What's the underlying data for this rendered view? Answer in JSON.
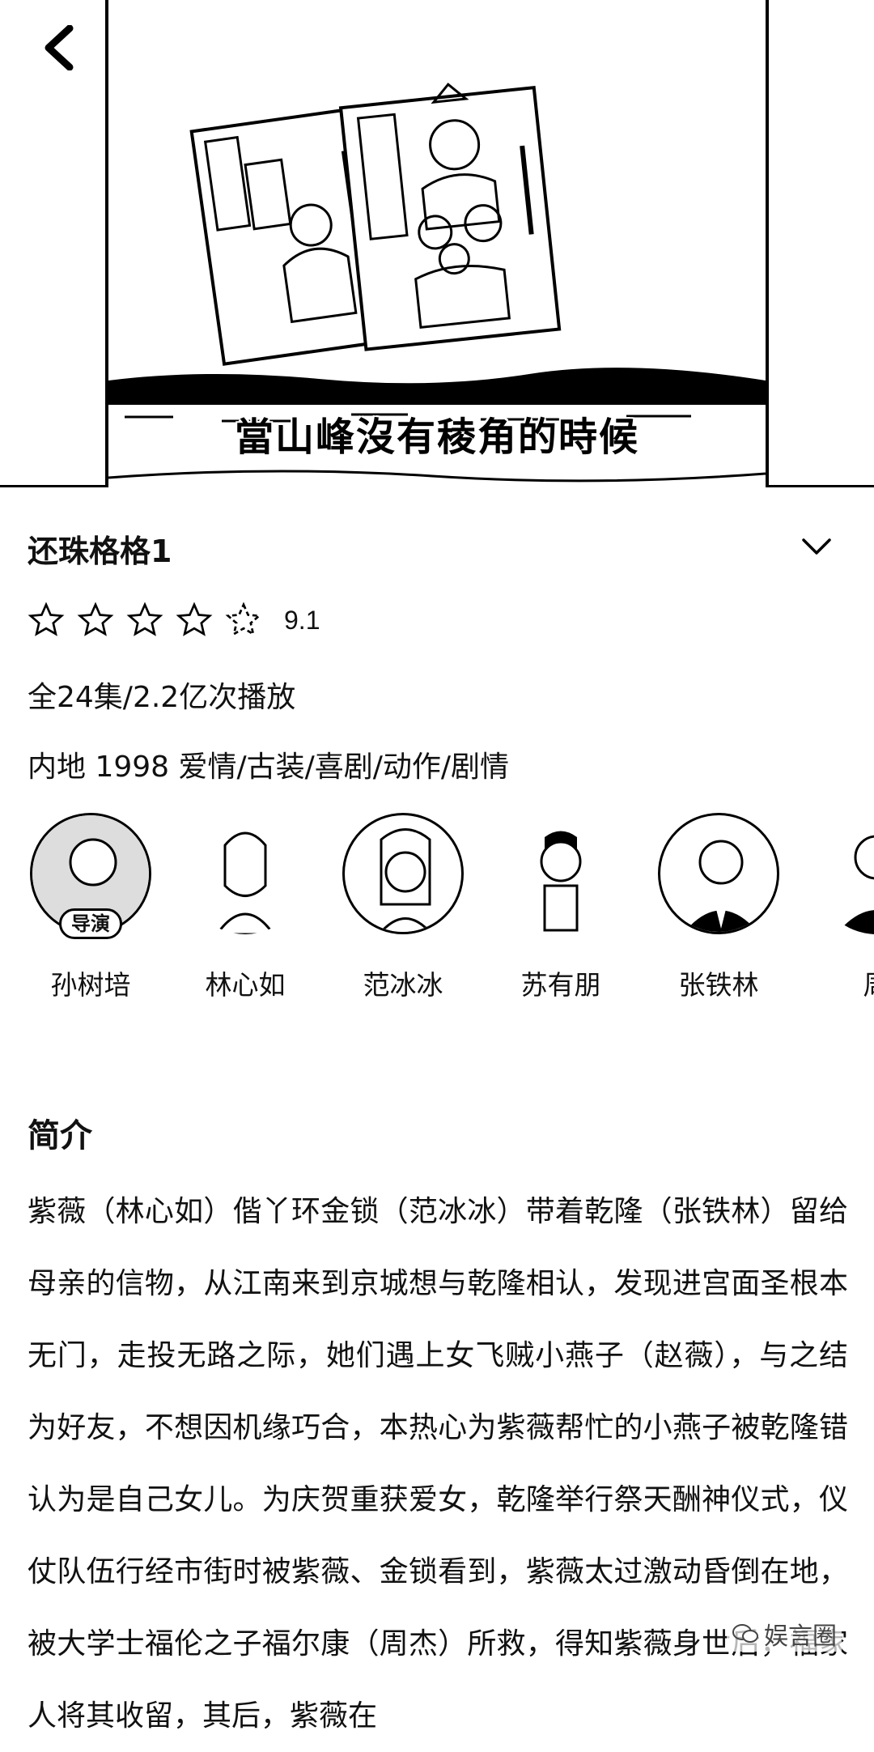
{
  "player": {
    "subtitle": "當山峰沒有稜角的時候"
  },
  "show": {
    "title": "还珠格格1",
    "rating": {
      "stars": 4.5,
      "max_stars": 5,
      "score": "9.1"
    },
    "episodes_plays": "全24集/2.2亿次播放",
    "meta": "内地 1998 爱情/古装/喜剧/动作/剧情"
  },
  "cast": [
    {
      "name": "孙树培",
      "role": "导演"
    },
    {
      "name": "林心如"
    },
    {
      "name": "范冰冰"
    },
    {
      "name": "苏有朋"
    },
    {
      "name": "张铁林"
    },
    {
      "name": "周"
    }
  ],
  "synopsis": {
    "heading": "简介",
    "text": "紫薇（林心如）偕丫环金锁（范冰冰）带着乾隆（张铁林）留给母亲的信物，从江南来到京城想与乾隆相认，发现进宫面圣根本无门，走投无路之际，她们遇上女飞贼小燕子（赵薇），与之结为好友，不想因机缘巧合，本热心为紫薇帮忙的小燕子被乾隆错认为是自己女儿。为庆贺重获爱女，乾隆举行祭天酬神仪式，仪仗队伍行经市街时被紫薇、金锁看到，紫薇太过激动昏倒在地，被大学士福伦之子福尔康（周杰）所救，得知紫薇身世后，福家人将其收留，其后，紫薇在"
  },
  "watermark": "娱言圈"
}
